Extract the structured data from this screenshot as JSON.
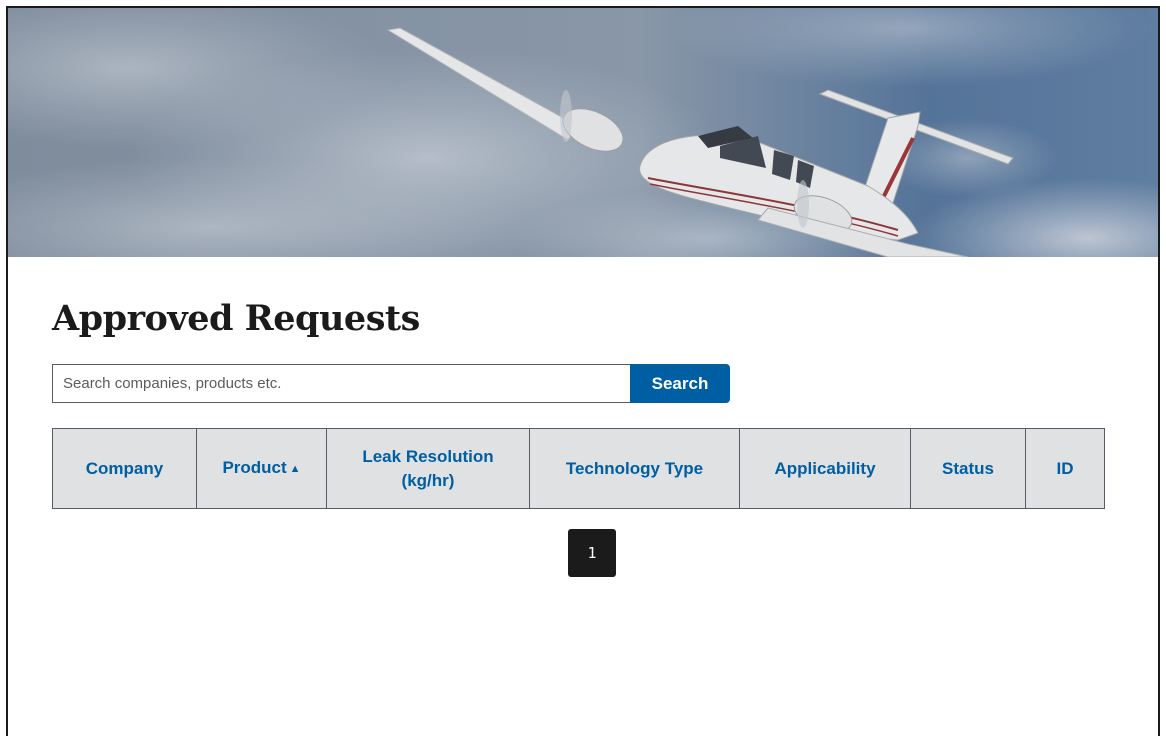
{
  "hero": {
    "image_name": "twin-engine-airplane-in-clouds"
  },
  "page_title": "Approved Requests",
  "search": {
    "placeholder": "Search companies, products etc.",
    "value": "",
    "button_label": "Search"
  },
  "table": {
    "columns": [
      {
        "label": "Company",
        "sort": ""
      },
      {
        "label": "Product",
        "sort": "▲"
      },
      {
        "label": "Leak Resolution (kg/hr)",
        "sort": ""
      },
      {
        "label": "Technology Type",
        "sort": ""
      },
      {
        "label": "Applicability",
        "sort": ""
      },
      {
        "label": "Status",
        "sort": ""
      },
      {
        "label": "ID",
        "sort": ""
      }
    ],
    "rows": []
  },
  "pagination": {
    "current_page": "1"
  },
  "colors": {
    "link": "#005ea2",
    "header_bg": "#dfe1e2",
    "pager_bg": "#1b1b1b"
  }
}
